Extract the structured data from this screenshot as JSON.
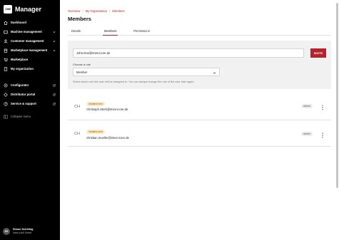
{
  "app": {
    "brand_logo_text": "OSM",
    "title": "Manager"
  },
  "sidebar": {
    "items": [
      {
        "label": "Dashboard",
        "icon": "home-icon",
        "trailing": ""
      },
      {
        "label": "Machine management",
        "icon": "machine-icon",
        "trailing": "chevron-down-icon"
      },
      {
        "label": "Customer management",
        "icon": "users-icon",
        "trailing": "chevron-down-icon"
      },
      {
        "label": "Marketplace management",
        "icon": "store-icon",
        "trailing": "chevron-down-icon"
      },
      {
        "label": "Marketplace",
        "icon": "cart-icon",
        "trailing": ""
      },
      {
        "label": "My organization",
        "icon": "building-icon",
        "trailing": ""
      }
    ],
    "external_items": [
      {
        "label": "Configurator",
        "icon": "configurator-icon",
        "trailing": "external-link-icon"
      },
      {
        "label": "Distributor portal",
        "icon": "portal-icon",
        "trailing": "external-link-icon"
      },
      {
        "label": "Service & support",
        "icon": "help-icon",
        "trailing": "external-link-icon"
      }
    ],
    "collapse_label": "Collapse menu",
    "user": {
      "initials": "SS",
      "name": "Simon Schilling",
      "org": "imes-icore GmbH"
    }
  },
  "breadcrumb": [
    "Overview",
    "My Organization",
    "Members"
  ],
  "page_title": "Members",
  "tabs": [
    {
      "label": "Details",
      "active": false
    },
    {
      "label": "Members",
      "active": true
    },
    {
      "label": "Permissions",
      "active": false
    }
  ],
  "invite": {
    "email_value": "John.Doe@imes-icore.de",
    "button_label": "INVITE",
    "role_label": "Choose a role",
    "role_value": "Member",
    "hint": "Select which role this user will be assigned to. You can always change the role of the user later again."
  },
  "members": [
    {
      "initials": "CH",
      "badge": "Invitation sent",
      "email": "Christoph.Stork@imes-icore.de",
      "role": "Admin"
    },
    {
      "initials": "CH",
      "badge": "Invitation sent",
      "email": "christian.mueller@imes-icore.de",
      "role": "Admin"
    }
  ],
  "colors": {
    "accent": "#b4232b",
    "sidebar_bg": "#000000",
    "badge_bg": "#fde9c4"
  }
}
